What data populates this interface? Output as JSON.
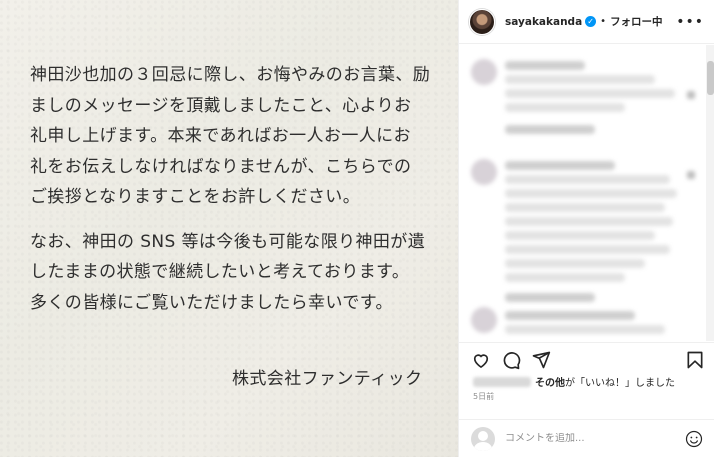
{
  "post": {
    "letter_lines": [
      "神田沙也加の３回忌に際し、お悔やみのお言葉、励",
      "ましのメッセージを頂戴しましたこと、心よりお",
      "礼申し上げます。本来であればお一人お一人にお",
      "礼をお伝えしなければなりませんが、こちらでの",
      "ご挨拶となりますことをお許しください。",
      "なお、神田の SNS 等は今後も可能な限り神田が遺",
      "したままの状態で継続したいと考えております。",
      "多くの皆様にご覧いただけましたら幸いです。"
    ],
    "signature": "株式会社ファンティック"
  },
  "header": {
    "username": "sayakakanda",
    "verified_mark": "✓",
    "separator": "•",
    "follow_label": "フォロー中",
    "more_label": "•••"
  },
  "engagement": {
    "likes_text": "その他",
    "likes_suffix": "が「いいね！」しました",
    "time": "5日前"
  },
  "comment_box": {
    "placeholder": "コメントを追加..."
  },
  "icons": [
    "heart-icon",
    "comment-icon",
    "share-icon",
    "bookmark-icon",
    "emoji-icon",
    "more-icon",
    "verified-icon"
  ],
  "colors": {
    "verified": "#0095f6",
    "text": "#262626",
    "muted": "#8e8e8e",
    "paper": "#efede6"
  }
}
